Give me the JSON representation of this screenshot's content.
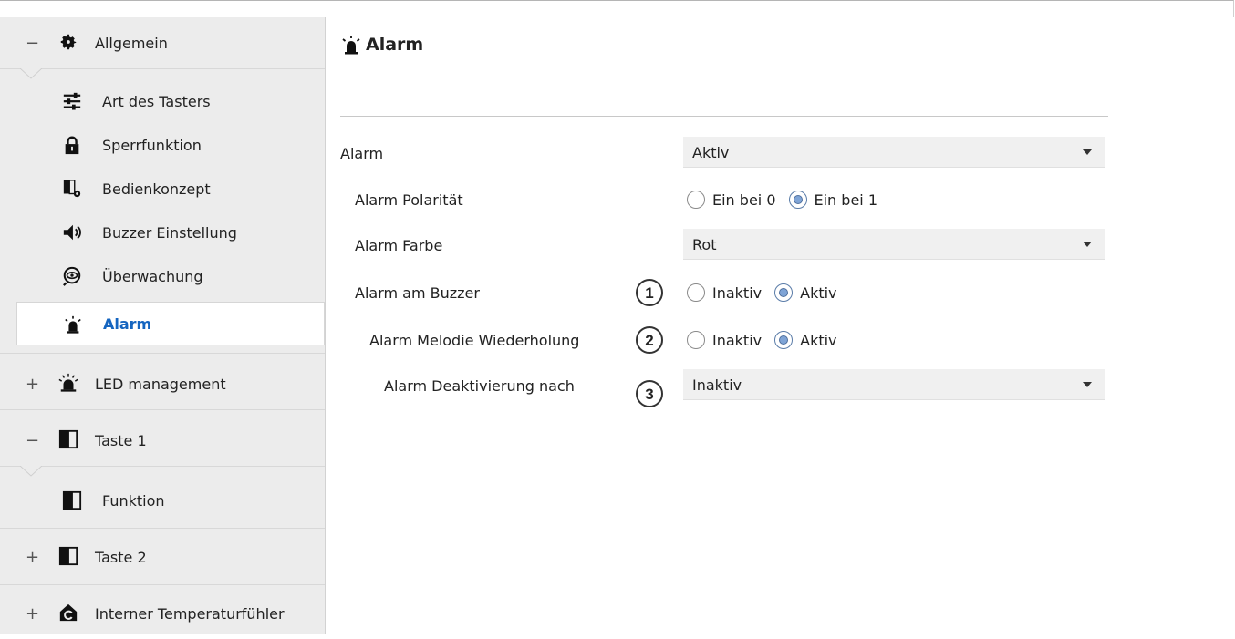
{
  "sidebar": {
    "groups": [
      {
        "sign": "−",
        "icon": "gear-icon",
        "label": "Allgemein"
      },
      {
        "sign": "+",
        "icon": "led-icon",
        "label": "LED management"
      },
      {
        "sign": "−",
        "icon": "button-panel-icon",
        "label": "Taste 1"
      },
      {
        "sign": "+",
        "icon": "button-panel-icon",
        "label": "Taste 2"
      },
      {
        "sign": "+",
        "icon": "thermometer-house-icon",
        "label": "Interner Temperaturfühler"
      }
    ],
    "general_items": [
      {
        "icon": "sliders-icon",
        "label": "Art des Tasters"
      },
      {
        "icon": "lock-icon",
        "label": "Sperrfunktion"
      },
      {
        "icon": "control-concept-icon",
        "label": "Bedienkonzept"
      },
      {
        "icon": "speaker-icon",
        "label": "Buzzer Einstellung"
      },
      {
        "icon": "eye-icon",
        "label": "Überwachung"
      },
      {
        "icon": "alarm-icon",
        "label": "Alarm",
        "active": true
      }
    ],
    "taste1_items": [
      {
        "icon": "button-panel-icon",
        "label": "Funktion"
      }
    ]
  },
  "main": {
    "title": "Alarm",
    "title_icon": "alarm-icon",
    "params": [
      {
        "label": "Alarm",
        "type": "select",
        "value": "Aktiv"
      },
      {
        "label": "Alarm Polarität",
        "type": "radio",
        "options": [
          "Ein bei 0",
          "Ein bei 1"
        ],
        "selected": "Ein bei 1"
      },
      {
        "label": "Alarm Farbe",
        "type": "select",
        "value": "Rot"
      },
      {
        "label": "Alarm am Buzzer",
        "type": "radio",
        "options": [
          "Inaktiv",
          "Aktiv"
        ],
        "selected": "Aktiv",
        "badge": "1"
      },
      {
        "label": "Alarm Melodie Wiederholung",
        "type": "radio",
        "options": [
          "Inaktiv",
          "Aktiv"
        ],
        "selected": "Aktiv",
        "badge": "2"
      },
      {
        "label": "Alarm Deaktivierung nach",
        "type": "select",
        "value": "Inaktiv",
        "badge": "3"
      }
    ]
  },
  "colors": {
    "accent": "#1565c0",
    "sidebar_bg": "#ececec",
    "select_bg": "#f0f0f0",
    "radio_fill": "#7fa4d6"
  }
}
